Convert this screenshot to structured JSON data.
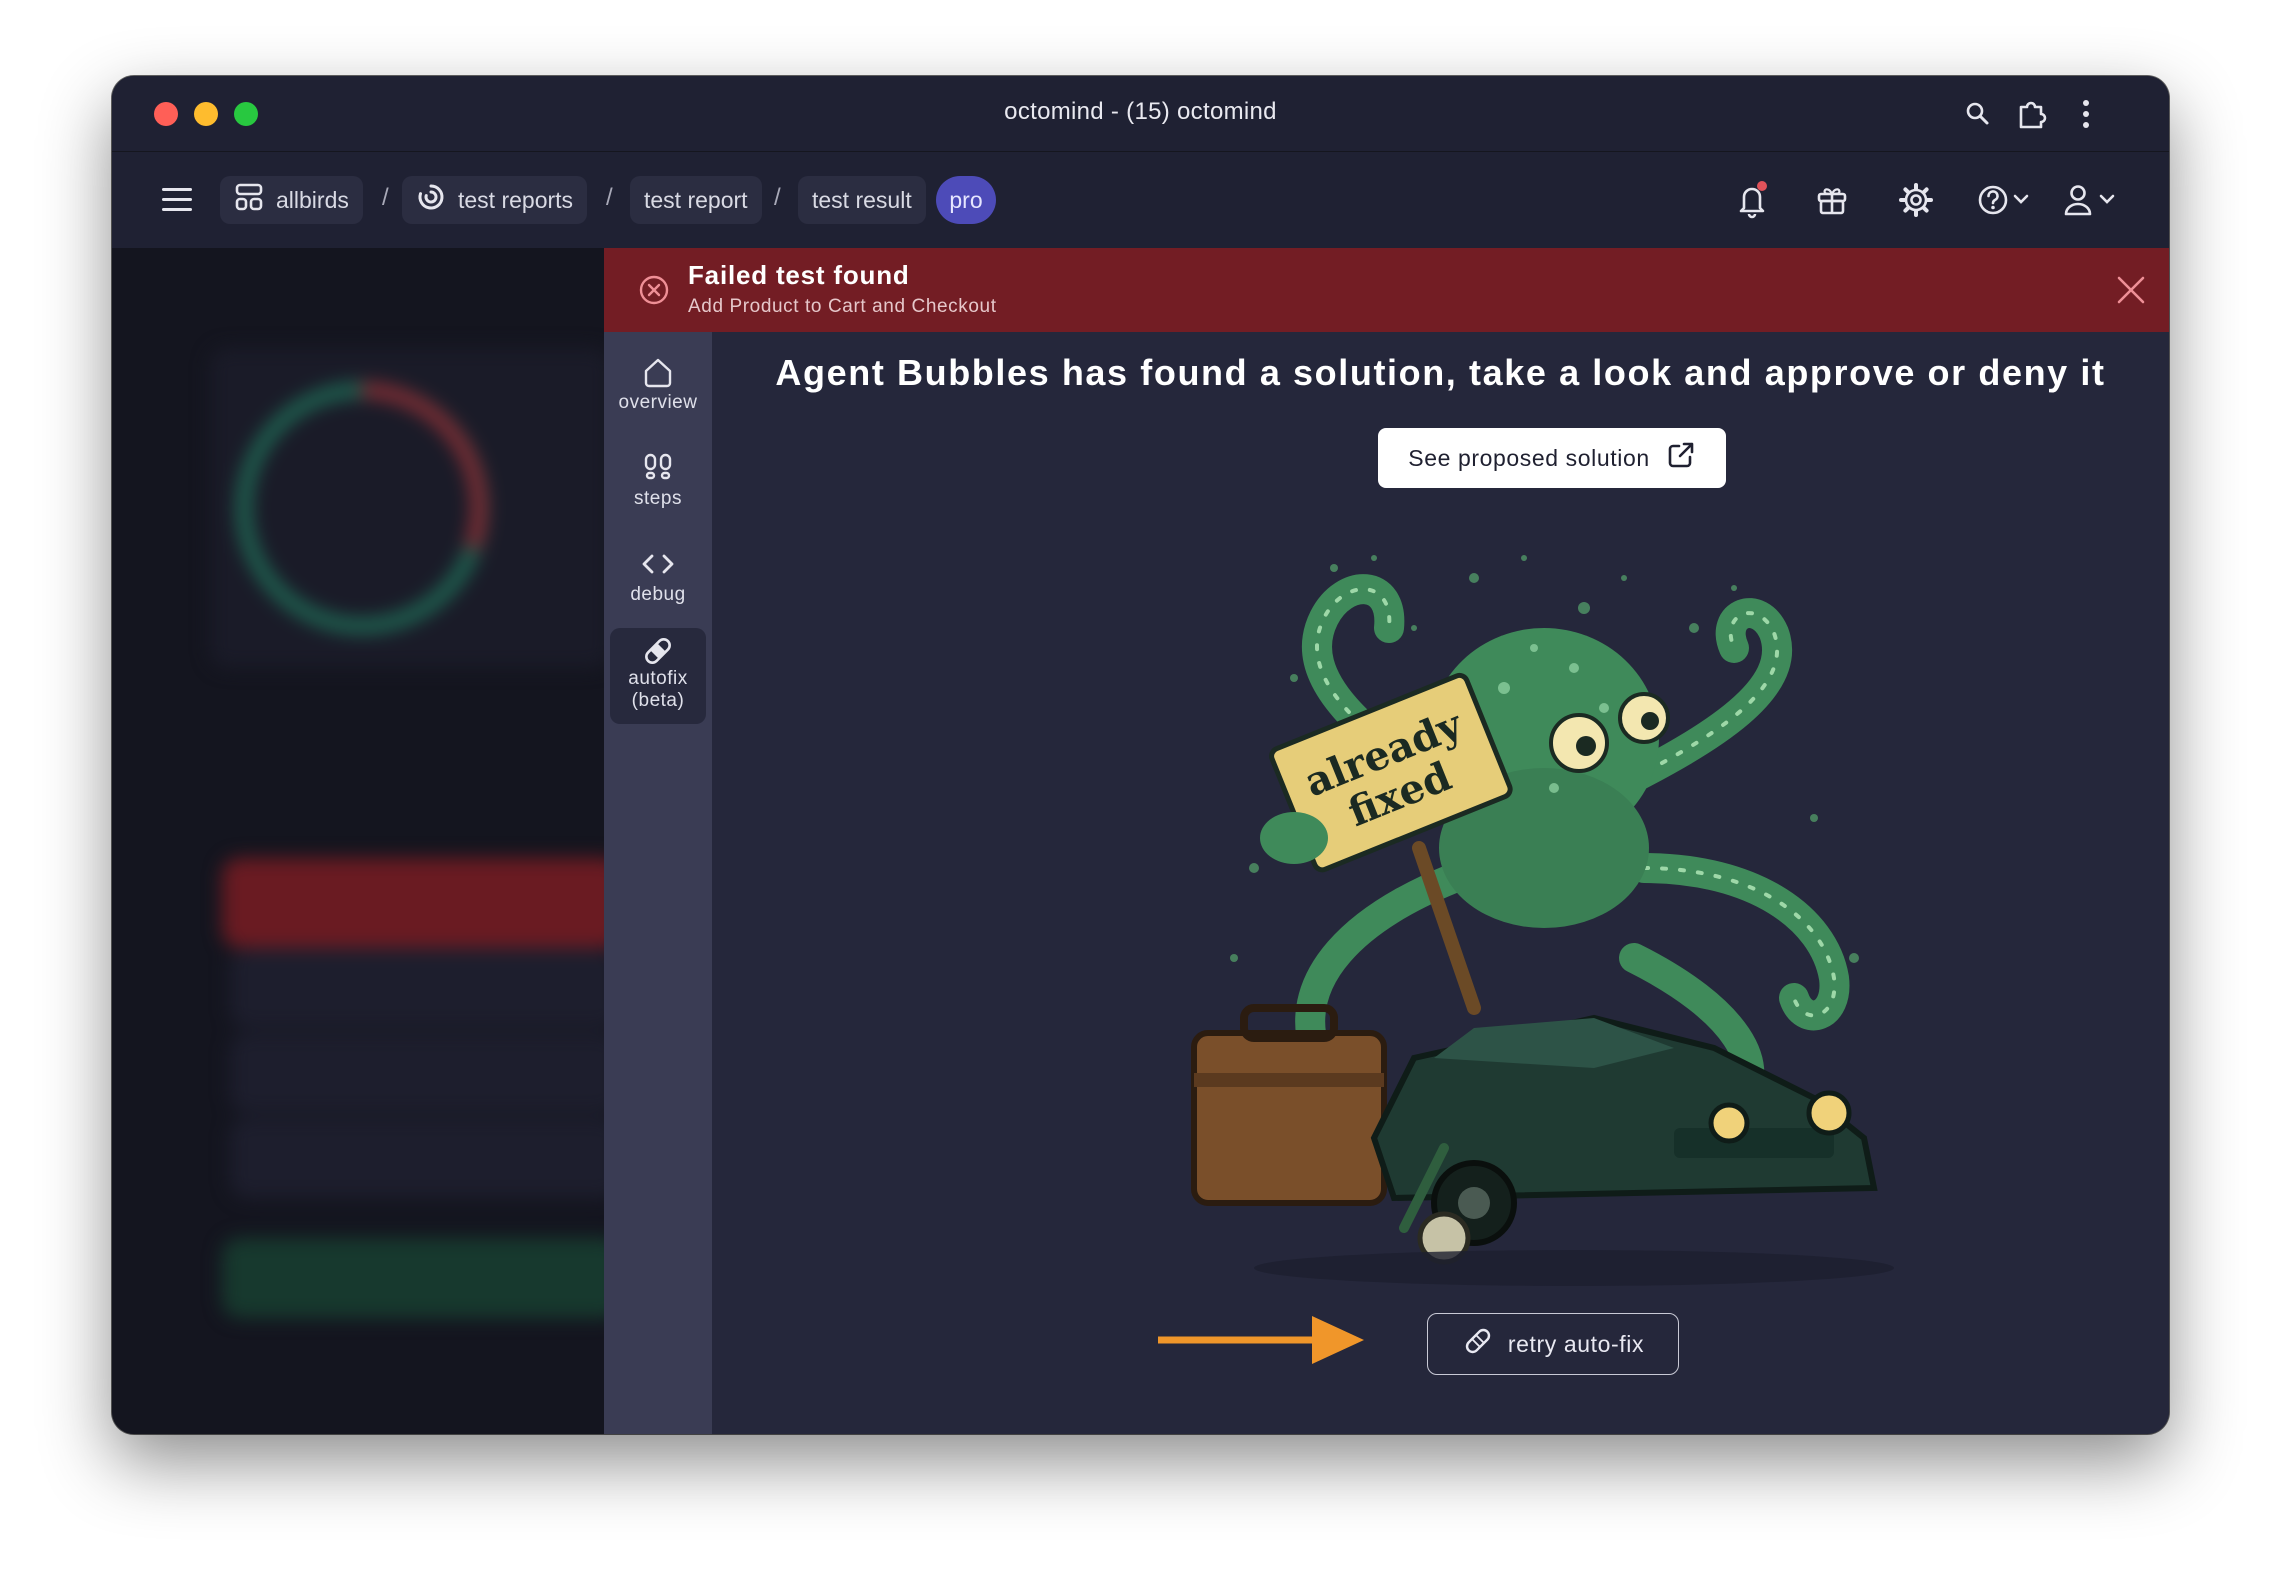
{
  "window": {
    "title": "octomind - (15) octomind"
  },
  "titlebar_icons": [
    "zoom-icon",
    "extension-icon",
    "more-vertical-icon"
  ],
  "breadcrumbs": [
    {
      "label": "allbirds",
      "icon": "project-icon"
    },
    {
      "label": "test reports",
      "icon": "reports-icon"
    },
    {
      "label": "test report"
    },
    {
      "label": "test result"
    }
  ],
  "separator": "/",
  "badge": {
    "label": "pro",
    "color": "#4d4bb8"
  },
  "topbar_icons": [
    "bell-icon",
    "gift-icon",
    "gear-icon",
    "help-icon",
    "user-icon"
  ],
  "banner": {
    "title": "Failed test found",
    "subtitle": "Add Product to Cart and Checkout",
    "color": "#731d24"
  },
  "sidenav": [
    {
      "label": "overview",
      "icon": "home-icon",
      "active": false
    },
    {
      "label": "steps",
      "icon": "footsteps-icon",
      "active": false
    },
    {
      "label": "debug",
      "icon": "code-icon",
      "active": false
    },
    {
      "label": "autofix",
      "label2": "(beta)",
      "icon": "bandage-icon",
      "active": true
    }
  ],
  "main": {
    "heading": "Agent Bubbles has found a solution, take a look and approve or deny it",
    "solution_button": "See proposed solution",
    "illustration_sign_line1": "already",
    "illustration_sign_line2": "fixed",
    "retry_button": "retry auto-fix",
    "arrow_color": "#f0962a"
  }
}
